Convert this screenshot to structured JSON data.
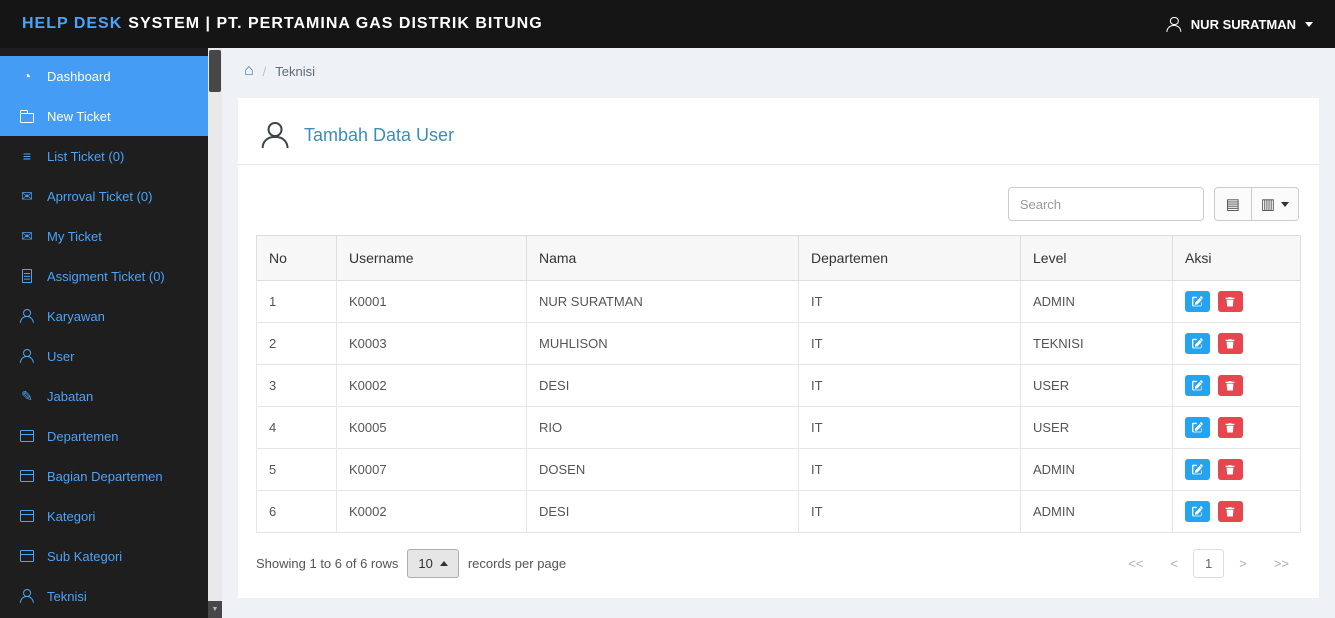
{
  "topbar": {
    "brand_primary": "HELP DESK",
    "brand_secondary": "SYSTEM | PT. PERTAMINA GAS DISTRIK BITUNG",
    "user_name": "NUR SURATMAN"
  },
  "sidebar": {
    "items": [
      {
        "id": "dashboard",
        "label": "Dashboard",
        "icon": "gauge-icon",
        "active": true
      },
      {
        "id": "new-ticket",
        "label": "New Ticket",
        "icon": "folder-icon",
        "active": true
      },
      {
        "id": "list-ticket",
        "label": "List Ticket (0)",
        "icon": "list-icon",
        "active": false
      },
      {
        "id": "approval-ticket",
        "label": "Aprroval Ticket (0)",
        "icon": "mail-icon",
        "active": false
      },
      {
        "id": "my-ticket",
        "label": "My Ticket",
        "icon": "mail-open-icon",
        "active": false
      },
      {
        "id": "assignment-ticket",
        "label": "Assigment Ticket (0)",
        "icon": "file-icon",
        "active": false
      },
      {
        "id": "karyawan",
        "label": "Karyawan",
        "icon": "person-icon",
        "active": false
      },
      {
        "id": "user",
        "label": "User",
        "icon": "person-icon",
        "active": false
      },
      {
        "id": "jabatan",
        "label": "Jabatan",
        "icon": "pencil-icon",
        "active": false
      },
      {
        "id": "departemen",
        "label": "Departemen",
        "icon": "window-icon",
        "active": false
      },
      {
        "id": "bagian-departemen",
        "label": "Bagian Departemen",
        "icon": "window-icon",
        "active": false
      },
      {
        "id": "kategori",
        "label": "Kategori",
        "icon": "window-icon",
        "active": false
      },
      {
        "id": "sub-kategori",
        "label": "Sub Kategori",
        "icon": "window-icon",
        "active": false
      },
      {
        "id": "teknisi",
        "label": "Teknisi",
        "icon": "person-icon",
        "active": false
      }
    ]
  },
  "breadcrumb": {
    "home_icon": "home-icon",
    "separator": "/",
    "current": "Teknisi"
  },
  "panel": {
    "title": "Tambah Data User",
    "title_icon": "person-icon"
  },
  "toolbar": {
    "search_placeholder": "Search",
    "buttons": [
      {
        "name": "toggle-view",
        "icon": "list-view-icon"
      },
      {
        "name": "columns",
        "icon": "columns-icon"
      }
    ]
  },
  "table": {
    "columns": [
      "No",
      "Username",
      "Nama",
      "Departemen",
      "Level",
      "Aksi"
    ],
    "rows": [
      {
        "no": "1",
        "username": "K0001",
        "nama": "NUR SURATMAN",
        "departemen": "IT",
        "level": "ADMIN"
      },
      {
        "no": "2",
        "username": "K0003",
        "nama": "MUHLISON",
        "departemen": "IT",
        "level": "TEKNISI"
      },
      {
        "no": "3",
        "username": "K0002",
        "nama": "DESI",
        "departemen": "IT",
        "level": "USER"
      },
      {
        "no": "4",
        "username": "K0005",
        "nama": "RIO",
        "departemen": "IT",
        "level": "USER"
      },
      {
        "no": "5",
        "username": "K0007",
        "nama": "DOSEN",
        "departemen": "IT",
        "level": "ADMIN"
      },
      {
        "no": "6",
        "username": "K0002",
        "nama": "DESI",
        "departemen": "IT",
        "level": "ADMIN"
      }
    ],
    "row_actions": [
      "edit",
      "delete"
    ]
  },
  "footer": {
    "summary": "Showing 1 to 6 of 6 rows",
    "page_size": "10",
    "records_label": "records per page",
    "pagination": [
      {
        "label": "<<",
        "active": false
      },
      {
        "label": "<",
        "active": false
      },
      {
        "label": "1",
        "active": true
      },
      {
        "label": ">",
        "active": false
      },
      {
        "label": ">>",
        "active": false
      }
    ]
  },
  "colors": {
    "accent_blue": "#459cf4",
    "brand_blue": "#4da3f7",
    "edit_button": "#23a3f0",
    "delete_button": "#e8464f",
    "topbar_bg": "#151515",
    "sidebar_bg": "#1e1e1e"
  }
}
